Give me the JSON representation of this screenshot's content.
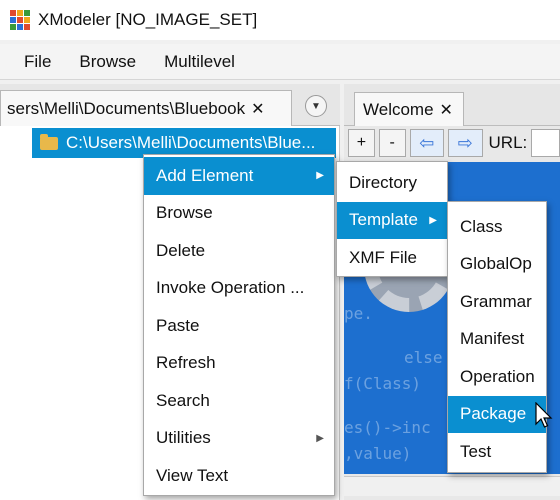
{
  "window": {
    "title": "XModeler  [NO_IMAGE_SET]"
  },
  "menubar": {
    "items": [
      {
        "label": "File"
      },
      {
        "label": "Browse"
      },
      {
        "label": "Multilevel"
      }
    ]
  },
  "left_pane": {
    "tab_label": "sers\\Melli\\Documents\\Bluebook",
    "tab_close": "✕",
    "tree_item": "C:\\Users\\Melli\\Documents\\Blue..."
  },
  "right_pane": {
    "tab_label": "Welcome",
    "tab_close": "✕",
    "toolbar": {
      "plus": "+",
      "minus": "-",
      "back": "⇦",
      "forward": "⇨",
      "url_label": "URL:"
    },
    "bg_code": [
      "pe.",
      "else",
      "f(Class)",
      "es()->inc",
      ",value)"
    ]
  },
  "context_menu": {
    "items": [
      {
        "label": "Add Element",
        "submenu": true,
        "highlighted": true
      },
      {
        "label": "Browse"
      },
      {
        "label": "Delete"
      },
      {
        "label": "Invoke Operation ..."
      },
      {
        "label": "Paste"
      },
      {
        "label": "Refresh"
      },
      {
        "label": "Search"
      },
      {
        "label": "Utilities",
        "submenu": true
      },
      {
        "label": "View Text"
      }
    ]
  },
  "add_element_submenu": {
    "items": [
      {
        "label": "Directory"
      },
      {
        "label": "Template",
        "submenu": true,
        "highlighted": true
      },
      {
        "label": "XMF File"
      }
    ]
  },
  "template_submenu": {
    "items": [
      {
        "label": "Class"
      },
      {
        "label": "GlobalOp"
      },
      {
        "label": "Grammar"
      },
      {
        "label": "Manifest"
      },
      {
        "label": "Operation"
      },
      {
        "label": "Package",
        "highlighted": true
      },
      {
        "label": "Test"
      }
    ]
  },
  "colors": {
    "accent": "#0a8fd0",
    "browser_bg": "#1d6fcf"
  }
}
